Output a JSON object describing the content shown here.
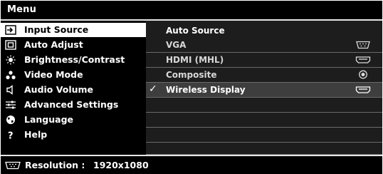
{
  "title": "Menu",
  "menu": {
    "items": [
      {
        "label": "Input Source",
        "icon": "input-source-icon",
        "selected": true
      },
      {
        "label": "Auto Adjust",
        "icon": "auto-adjust-icon"
      },
      {
        "label": "Brightness/Contrast",
        "icon": "brightness-icon"
      },
      {
        "label": "Video Mode",
        "icon": "video-mode-icon"
      },
      {
        "label": "Audio Volume",
        "icon": "speaker-icon"
      },
      {
        "label": "Advanced Settings",
        "icon": "sliders-icon"
      },
      {
        "label": "Language",
        "icon": "globe-icon"
      },
      {
        "label": "Help",
        "icon": "question-icon"
      }
    ]
  },
  "options": {
    "header": "Auto Source",
    "items": [
      {
        "label": "VGA",
        "icon": "vga-connector-icon"
      },
      {
        "label": "HDMI (MHL)",
        "icon": "hdmi-connector-icon"
      },
      {
        "label": "Composite",
        "icon": "rca-connector-icon"
      },
      {
        "label": "Wireless Display",
        "icon": "wireless-display-icon",
        "checked": true
      }
    ],
    "check_mark": "✓"
  },
  "footer": {
    "resolution_label": "Resolution :",
    "resolution_value": "1920x1080",
    "icon": "vga-connector-icon"
  },
  "colors": {
    "background": "#000000",
    "panel": "#1d1d1d",
    "selected_bg": "#ffffff",
    "active_option_bg": "#3e3e3e",
    "text": "#ffffff"
  }
}
